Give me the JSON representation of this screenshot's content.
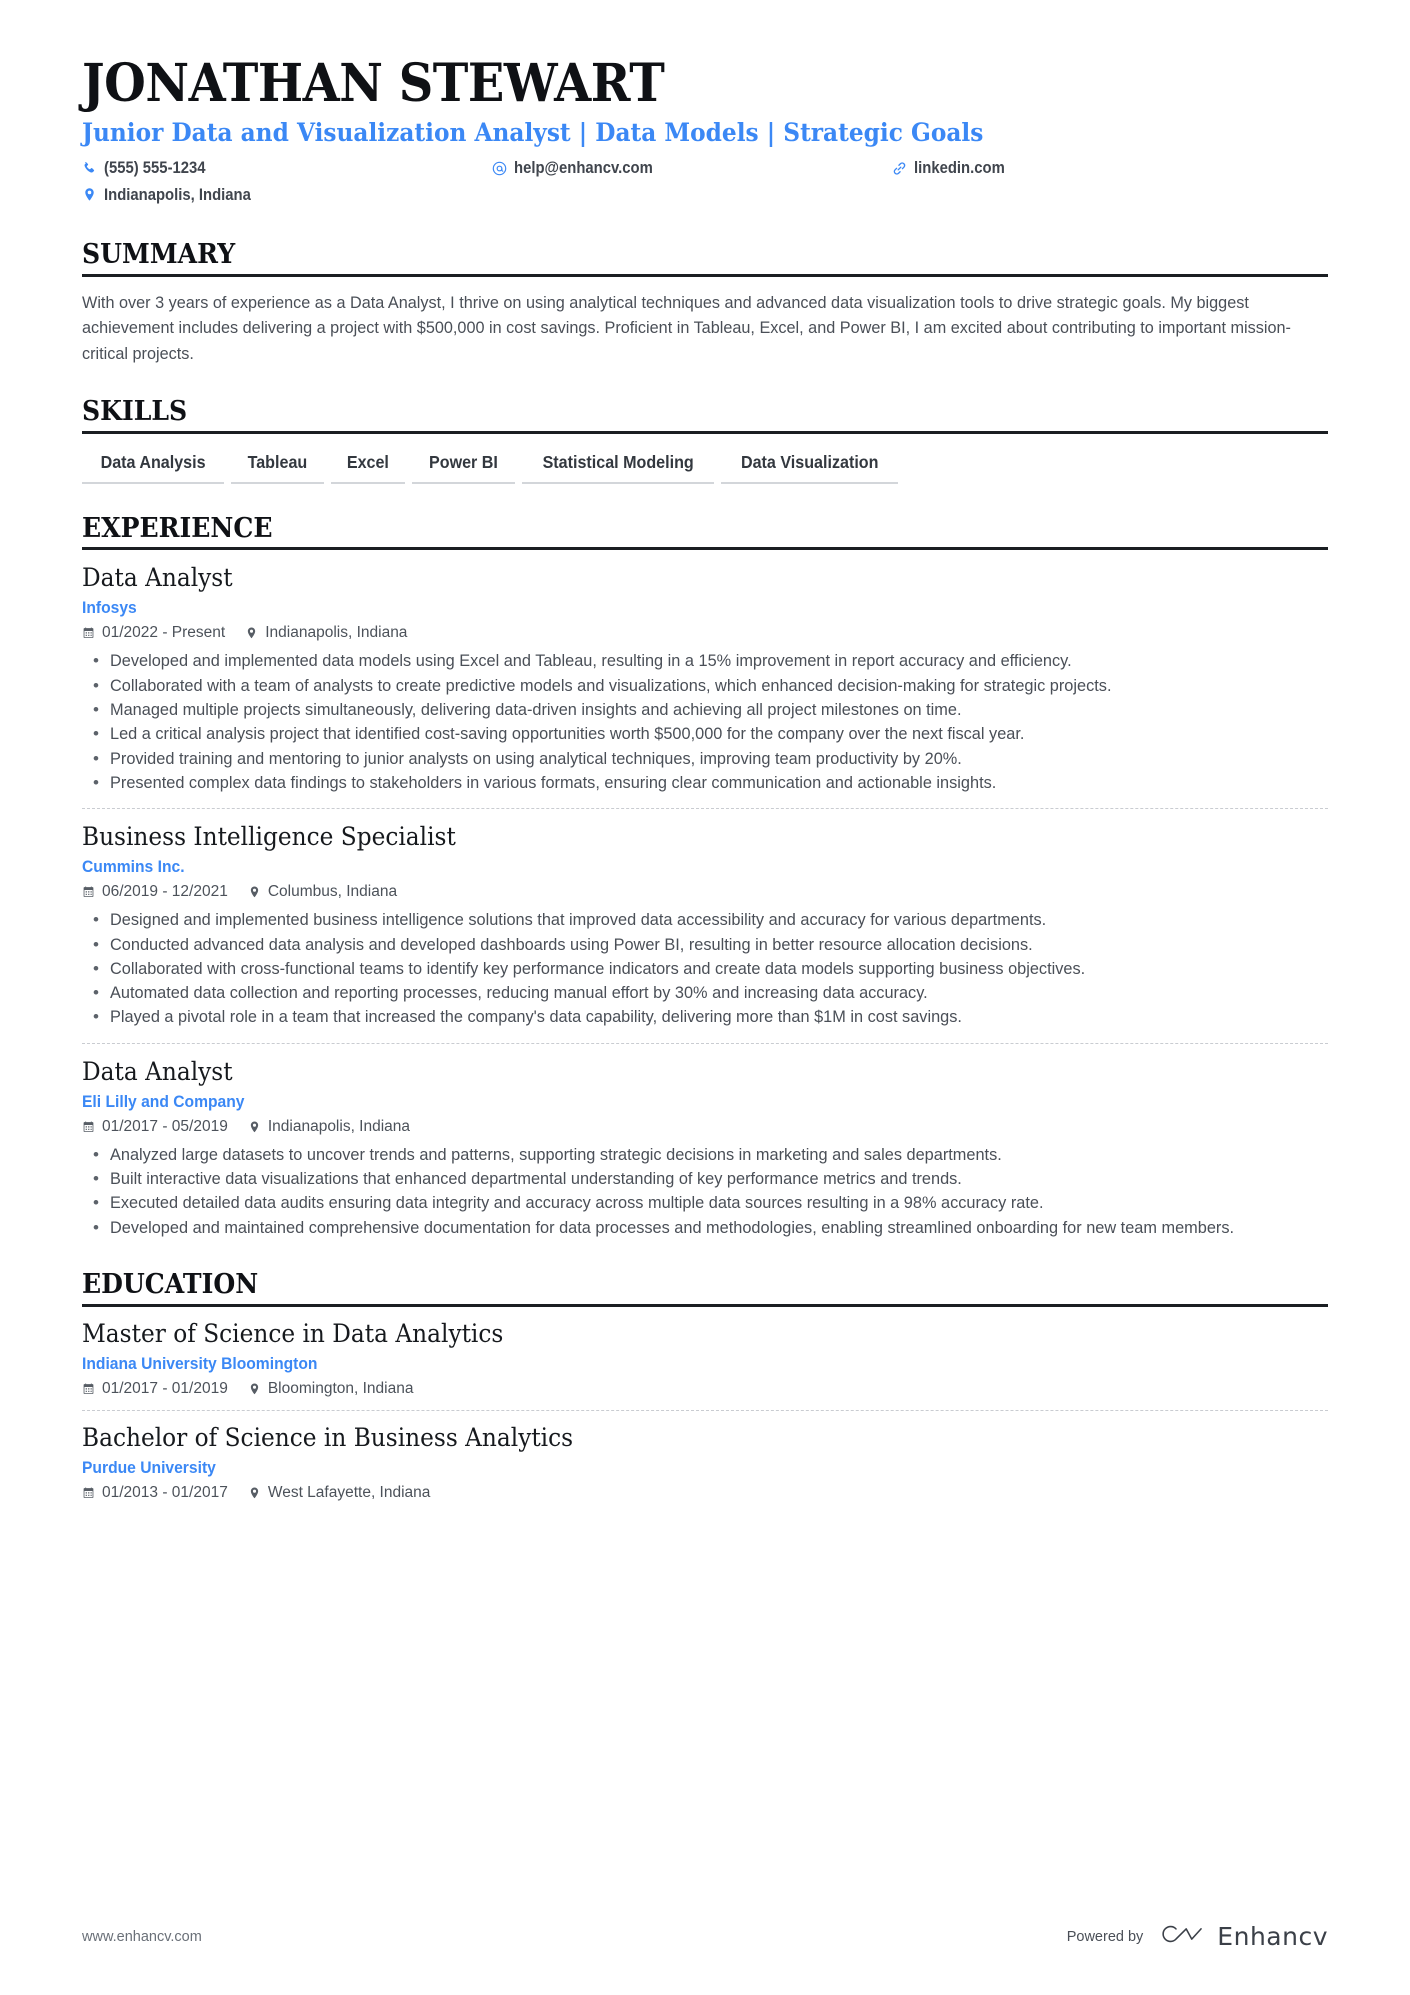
{
  "header": {
    "name": "JONATHAN STEWART",
    "headline": "Junior Data and Visualization Analyst | Data Models | Strategic Goals",
    "contacts": [
      {
        "icon": "phone-icon",
        "text": "(555) 555-1234"
      },
      {
        "icon": "email-icon",
        "text": "help@enhancv.com"
      },
      {
        "icon": "link-icon",
        "text": "linkedin.com"
      },
      {
        "icon": "location-pin-icon",
        "text": "Indianapolis, Indiana"
      }
    ]
  },
  "colors": {
    "accent_blue": "#3b88f5",
    "heading_black": "#0f1115",
    "body_gray": "#4a4f57",
    "rule_black": "#1b1e22",
    "dashed_gray": "#c9ccd1",
    "skill_underline": "#d3d6da"
  },
  "summary": {
    "title": "SUMMARY",
    "text": "With over 3 years of experience as a Data Analyst, I thrive on using analytical techniques and advanced data visualization tools to drive strategic goals. My biggest achievement includes delivering a project with $500,000 in cost savings. Proficient in Tableau, Excel, and Power BI, I am excited about contributing to important mission-critical projects."
  },
  "skills": {
    "title": "SKILLS",
    "items": [
      "Data Analysis",
      "Tableau",
      "Excel",
      "Power BI",
      "Statistical Modeling",
      "Data Visualization"
    ]
  },
  "experience": {
    "title": "EXPERIENCE",
    "entries": [
      {
        "role": "Data Analyst",
        "company": "Infosys",
        "dates": "01/2022 - Present",
        "location": "Indianapolis, Indiana",
        "bullets": [
          "Developed and implemented data models using Excel and Tableau, resulting in a 15% improvement in report accuracy and efficiency.",
          "Collaborated with a team of analysts to create predictive models and visualizations, which enhanced decision-making for strategic projects.",
          "Managed multiple projects simultaneously, delivering data-driven insights and achieving all project milestones on time.",
          "Led a critical analysis project that identified cost-saving opportunities worth $500,000 for the company over the next fiscal year.",
          "Provided training and mentoring to junior analysts on using analytical techniques, improving team productivity by 20%.",
          "Presented complex data findings to stakeholders in various formats, ensuring clear communication and actionable insights."
        ]
      },
      {
        "role": "Business Intelligence Specialist",
        "company": "Cummins Inc.",
        "dates": "06/2019 - 12/2021",
        "location": "Columbus, Indiana",
        "bullets": [
          "Designed and implemented business intelligence solutions that improved data accessibility and accuracy for various departments.",
          "Conducted advanced data analysis and developed dashboards using Power BI, resulting in better resource allocation decisions.",
          "Collaborated with cross-functional teams to identify key performance indicators and create data models supporting business objectives.",
          "Automated data collection and reporting processes, reducing manual effort by 30% and increasing data accuracy.",
          "Played a pivotal role in a team that increased the company's data capability, delivering more than $1M in cost savings."
        ]
      },
      {
        "role": "Data Analyst",
        "company": "Eli Lilly and Company",
        "dates": "01/2017 - 05/2019",
        "location": "Indianapolis, Indiana",
        "bullets": [
          "Analyzed large datasets to uncover trends and patterns, supporting strategic decisions in marketing and sales departments.",
          "Built interactive data visualizations that enhanced departmental understanding of key performance metrics and trends.",
          "Executed detailed data audits ensuring data integrity and accuracy across multiple data sources resulting in a 98% accuracy rate.",
          "Developed and maintained comprehensive documentation for data processes and methodologies, enabling streamlined onboarding for new team members."
        ]
      }
    ]
  },
  "education": {
    "title": "EDUCATION",
    "entries": [
      {
        "degree": "Master of Science in Data Analytics",
        "school": "Indiana University Bloomington",
        "dates": "01/2017 - 01/2019",
        "location": "Bloomington, Indiana"
      },
      {
        "degree": "Bachelor of Science in Business Analytics",
        "school": "Purdue University",
        "dates": "01/2013 - 01/2017",
        "location": "West Lafayette, Indiana"
      }
    ]
  },
  "footer": {
    "url": "www.enhancv.com",
    "powered_by": "Powered by",
    "brand": "Enhancv"
  }
}
